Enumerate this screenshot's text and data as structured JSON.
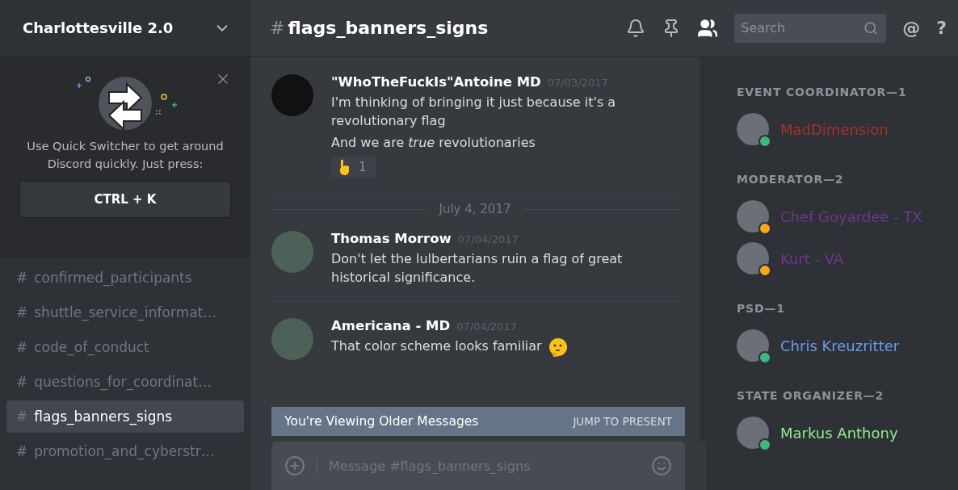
{
  "server": {
    "name": "Charlottesville 2.0"
  },
  "quick_switcher": {
    "text": "Use Quick Switcher to get around Discord quickly. Just press:",
    "shortcut": "CTRL + K"
  },
  "channels": [
    {
      "hash": "#",
      "name": "confirmed_participants",
      "selected": false
    },
    {
      "hash": "#",
      "name": "shuttle_service_informat…",
      "selected": false
    },
    {
      "hash": "#",
      "name": "code_of_conduct",
      "selected": false
    },
    {
      "hash": "#",
      "name": "questions_for_coordinat…",
      "selected": false
    },
    {
      "hash": "#",
      "name": "flags_banners_signs",
      "selected": true
    },
    {
      "hash": "#",
      "name": "promotion_and_cyberstr…",
      "selected": false
    }
  ],
  "header": {
    "hash": "#",
    "channel": "flags_banners_signs",
    "search_placeholder": "Search",
    "mention": "@",
    "help": "?"
  },
  "messages": [
    {
      "kind": "message",
      "author": "\"WhoTheFuckIs\"Antoine MD",
      "time": "07/03/2017",
      "lines": [
        "I'm thinking of bringing it just because it's a revolutionary flag",
        "And we are *true* revolutionaries"
      ],
      "reaction": {
        "count": "1"
      }
    },
    {
      "kind": "divider",
      "label": "July 4, 2017"
    },
    {
      "kind": "message",
      "author": "Thomas Morrow",
      "time": "07/04/2017",
      "lines": [
        "Don't let the lulbertarians ruin a flag of great historical significance."
      ]
    },
    {
      "kind": "message",
      "author": "Americana - MD",
      "time": "07/04/2017",
      "lines": [
        "That color scheme looks familiar"
      ],
      "emoji": true
    }
  ],
  "older_bar": {
    "text": "You're Viewing Older Messages",
    "action": "JUMP TO PRESENT"
  },
  "composer": {
    "placeholder": "Message #flags_banners_signs"
  },
  "member_groups": [
    {
      "title": "EVENT COORDINATOR—1",
      "members": [
        {
          "name": "MadDimension",
          "color": "#a5322a",
          "status": {
            "color": "#43b581"
          }
        }
      ]
    },
    {
      "title": "MODERATOR—2",
      "members": [
        {
          "name": "Chef Goyardee - TX",
          "color": "#71368a",
          "status": {
            "color": "#faa61a"
          }
        },
        {
          "name": "Kurt - VA",
          "color": "#71368a",
          "status": {
            "color": "#faa61a"
          }
        }
      ]
    },
    {
      "title": "PSD—1",
      "members": [
        {
          "name": "Chris Kreuzritter",
          "color": "#6d9bf0",
          "status": {
            "color": "#43b581"
          }
        }
      ]
    },
    {
      "title": "STATE ORGANIZER—2",
      "members": [
        {
          "name": "Markus Anthony",
          "color": "#8ef08e",
          "status": {
            "color": "#43b581"
          }
        }
      ]
    }
  ]
}
